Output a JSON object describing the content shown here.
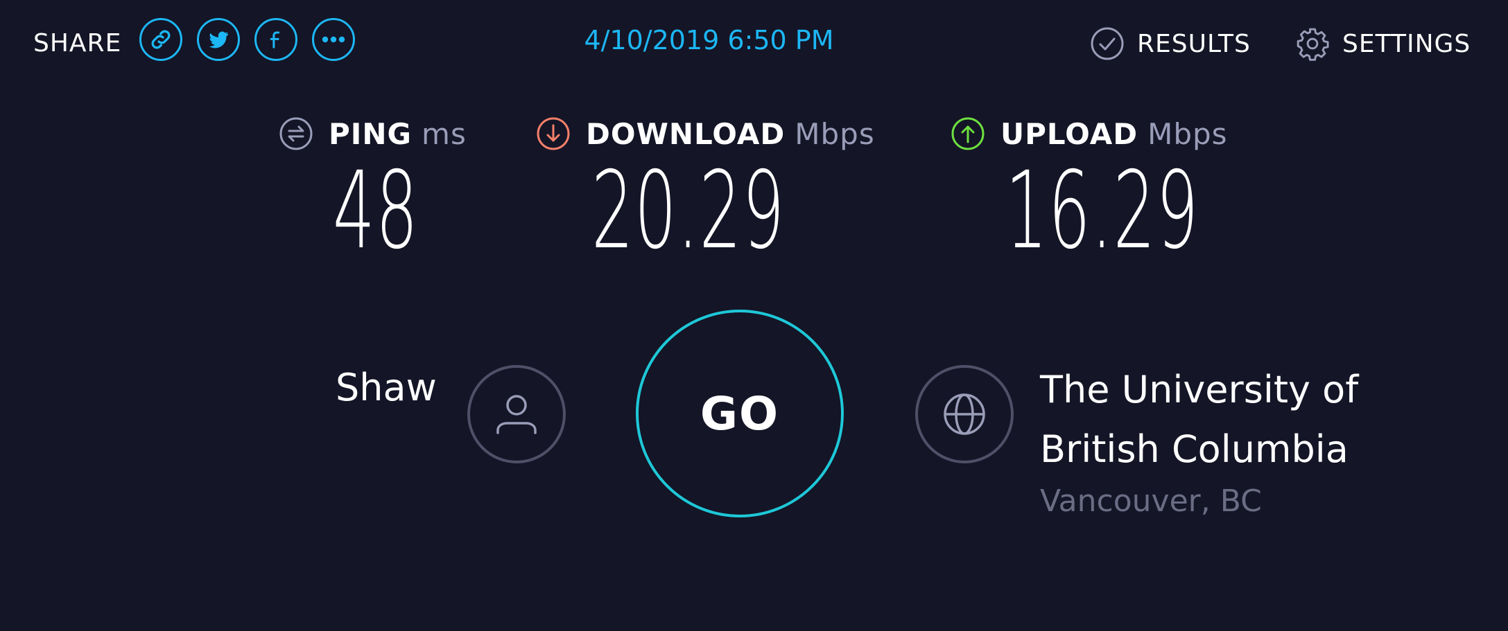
{
  "header": {
    "share_label": "SHARE",
    "share_buttons": [
      {
        "icon": "link-icon"
      },
      {
        "icon": "twitter-icon"
      },
      {
        "icon": "facebook-icon"
      },
      {
        "icon": "more-icon"
      }
    ],
    "timestamp": "4/10/2019 6:50 PM",
    "results_label": "RESULTS",
    "settings_label": "SETTINGS"
  },
  "metrics": {
    "ping": {
      "label": "PING",
      "unit": "ms",
      "value": "48",
      "icon": "ping-icon",
      "color": "#9a9db8"
    },
    "download": {
      "label": "DOWNLOAD",
      "unit": "Mbps",
      "value": "20.29",
      "icon": "download-icon",
      "color": "#f4806a"
    },
    "upload": {
      "label": "UPLOAD",
      "unit": "Mbps",
      "value": "16.29",
      "icon": "upload-icon",
      "color": "#6ee040"
    }
  },
  "connection": {
    "isp": "Shaw",
    "go_label": "GO",
    "server_name_line1": "The University of",
    "server_name_line2": "British Columbia",
    "server_location": "Vancouver, BC"
  },
  "colors": {
    "background": "#141526",
    "accent": "#1db7f5",
    "go_ring": "#1ec8d8",
    "muted": "#6b6d85"
  }
}
